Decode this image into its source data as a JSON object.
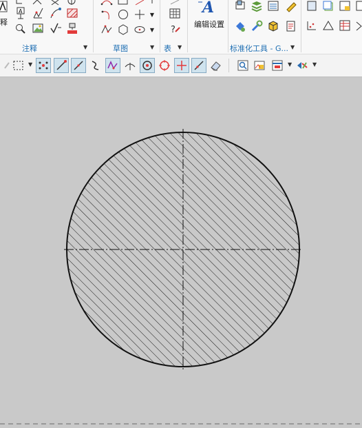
{
  "ribbon": {
    "groups": [
      {
        "label": "注释"
      },
      {
        "label": "草图"
      },
      {
        "label": "表"
      },
      {
        "label": "标准化工具 - G..."
      }
    ],
    "partial_label": "释",
    "edit_settings_label": "编辑设置"
  },
  "toolbar": {
    "items": [
      {
        "icon": "selection-rectangle-icon"
      },
      {
        "icon": "snap-point-icon"
      },
      {
        "icon": "line-endpoint-icon"
      },
      {
        "icon": "line-icon"
      },
      {
        "icon": "curve-icon"
      },
      {
        "icon": "polyline-snap-icon"
      },
      {
        "icon": "perpendicular-icon"
      },
      {
        "icon": "center-point-icon"
      },
      {
        "icon": "quadrant-icon"
      },
      {
        "icon": "intersection-icon"
      },
      {
        "icon": "midpoint-icon"
      },
      {
        "icon": "eraser-icon"
      },
      {
        "icon": "zoom-view-icon"
      },
      {
        "icon": "image-view-icon"
      },
      {
        "icon": "window-layout-icon"
      },
      {
        "icon": "view-options-icon"
      }
    ]
  },
  "drawing": {
    "shape": "circle",
    "fill": "cross-hatch",
    "hatch_color": "#1a1a1a",
    "background_color": "#c9c9c9",
    "centerlines": true
  }
}
